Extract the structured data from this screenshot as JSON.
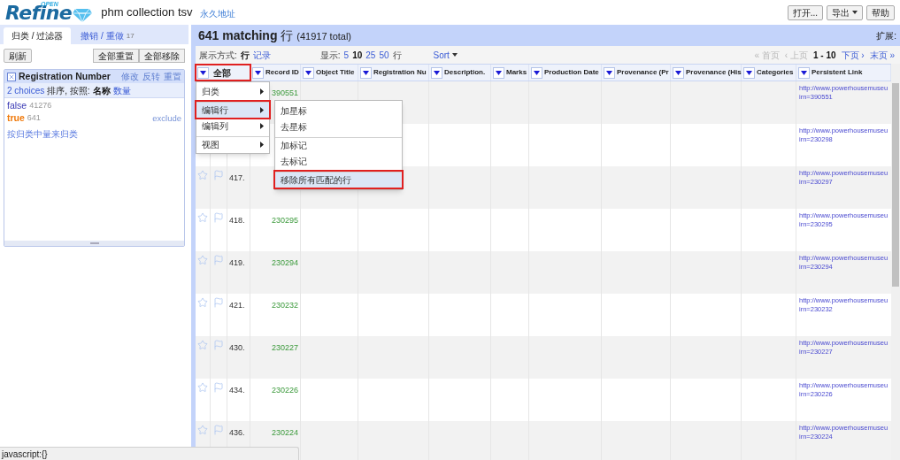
{
  "header": {
    "logo": "Refine",
    "logo_badge": "OPEN",
    "project_name": "phm collection tsv",
    "permalink": "永久地址",
    "buttons": [
      {
        "label": "打开...",
        "kind": "plain"
      },
      {
        "label": "导出",
        "kind": "dropdown"
      },
      {
        "label": "帮助",
        "kind": "plain"
      }
    ]
  },
  "left_tabs": [
    {
      "label": "归类 / 过滤器",
      "selected": true
    },
    {
      "label": "撤销 / 重做",
      "count": "17",
      "selected": false
    }
  ],
  "left_toolbar": {
    "refresh": "刷新",
    "buttons": [
      "全部重置",
      "全部移除"
    ]
  },
  "facet": {
    "title": "Registration Number",
    "actions": [
      "修改",
      "反转",
      "重置"
    ],
    "choices_count": "2 choices",
    "sort_label": "排序, 按照:",
    "sort_options": [
      {
        "label": "名称",
        "selected": true
      },
      {
        "label": "数量",
        "selected": false
      }
    ],
    "choices": [
      {
        "label": "false",
        "count": "41276",
        "selected": false
      },
      {
        "label": "true",
        "count": "641",
        "selected": true,
        "action": "exclude"
      }
    ],
    "footer_link": "按归类中量来归类"
  },
  "summary": {
    "count": "641 matching",
    "unit": "行",
    "total": "(41917 total)",
    "extensions": "扩展:"
  },
  "view_controls": {
    "show_as_label": "展示方式:",
    "show_as": [
      {
        "label": "行",
        "selected": true
      },
      {
        "label": "记录",
        "selected": false
      }
    ],
    "page_size_label": "显示:",
    "page_sizes": [
      {
        "label": "5",
        "selected": false
      },
      {
        "label": "10",
        "selected": true
      },
      {
        "label": "25",
        "selected": false
      },
      {
        "label": "50",
        "selected": false
      }
    ],
    "page_size_unit": "行",
    "sort": "Sort"
  },
  "pager": [
    {
      "label": "« 首页",
      "kind": "link",
      "disabled": true
    },
    {
      "label": "‹ 上页",
      "kind": "link",
      "disabled": true
    },
    {
      "label": "1 - 10",
      "kind": "range"
    },
    {
      "label": "下页 ›",
      "kind": "link",
      "disabled": false
    },
    {
      "label": "末页 »",
      "kind": "link",
      "disabled": false
    }
  ],
  "table": {
    "columns": [
      {
        "label": "全部",
        "outlined": true
      },
      {
        "label": "Record ID",
        "outlined": false
      },
      {
        "label": "Object Title",
        "outlined": false
      },
      {
        "label": "Registration Nu",
        "outlined": false
      },
      {
        "label": "Description.",
        "outlined": false
      },
      {
        "label": "Marks",
        "outlined": false
      },
      {
        "label": "Production Date",
        "outlined": false
      },
      {
        "label": "Provenance (Pr",
        "outlined": false
      },
      {
        "label": "Provenance (His",
        "outlined": false
      },
      {
        "label": "Categories",
        "outlined": false
      },
      {
        "label": "Persistent Link",
        "outlined": false
      }
    ],
    "rows": [
      {
        "record_id": "390551",
        "link": [
          "http://www.powerhousemuseu",
          "irn=390551"
        ]
      },
      {
        "link": [
          "http://www.powerhousemuseu",
          "irn=230298"
        ]
      },
      {
        "index": "417.",
        "link": [
          "http://www.powerhousemuseu",
          "irn=230297"
        ]
      },
      {
        "index": "418.",
        "record_id": "230295",
        "link": [
          "http://www.powerhousemuseu",
          "irn=230295"
        ]
      },
      {
        "index": "419.",
        "record_id": "230294",
        "link": [
          "http://www.powerhousemuseu",
          "irn=230294"
        ]
      },
      {
        "index": "421.",
        "record_id": "230232",
        "link": [
          "http://www.powerhousemuseu",
          "irn=230232"
        ]
      },
      {
        "index": "430.",
        "record_id": "230227",
        "link": [
          "http://www.powerhousemuseu",
          "irn=230227"
        ]
      },
      {
        "index": "434.",
        "record_id": "230226",
        "link": [
          "http://www.powerhousemuseu",
          "irn=230226"
        ]
      },
      {
        "index": "436.",
        "record_id": "230224",
        "link": [
          "http://www.powerhousemuseu",
          "irn=230224"
        ]
      }
    ]
  },
  "row_menu": {
    "items": [
      {
        "label": "归类",
        "kind": "submenu",
        "selected": false,
        "outlined": false,
        "divider_before": false
      },
      {
        "label": "编辑行",
        "kind": "submenu",
        "selected": true,
        "outlined": true,
        "divider_before": true
      },
      {
        "label": "编辑列",
        "kind": "submenu",
        "selected": false,
        "outlined": false,
        "divider_before": false
      },
      {
        "label": "视图",
        "kind": "submenu",
        "selected": false,
        "outlined": false,
        "divider_before": true
      }
    ],
    "submenu": [
      {
        "label": "加星标",
        "selected": false,
        "outlined": false,
        "divider_before": false
      },
      {
        "label": "去星标",
        "selected": false,
        "outlined": false,
        "divider_before": false
      },
      {
        "label": "加标记",
        "selected": false,
        "outlined": false,
        "divider_before": true
      },
      {
        "label": "去标记",
        "selected": false,
        "outlined": false,
        "divider_before": false
      },
      {
        "label": "移除所有匹配的行",
        "selected": true,
        "outlined": true,
        "divider_before": true
      }
    ]
  },
  "status_bar": "javascript:{}"
}
